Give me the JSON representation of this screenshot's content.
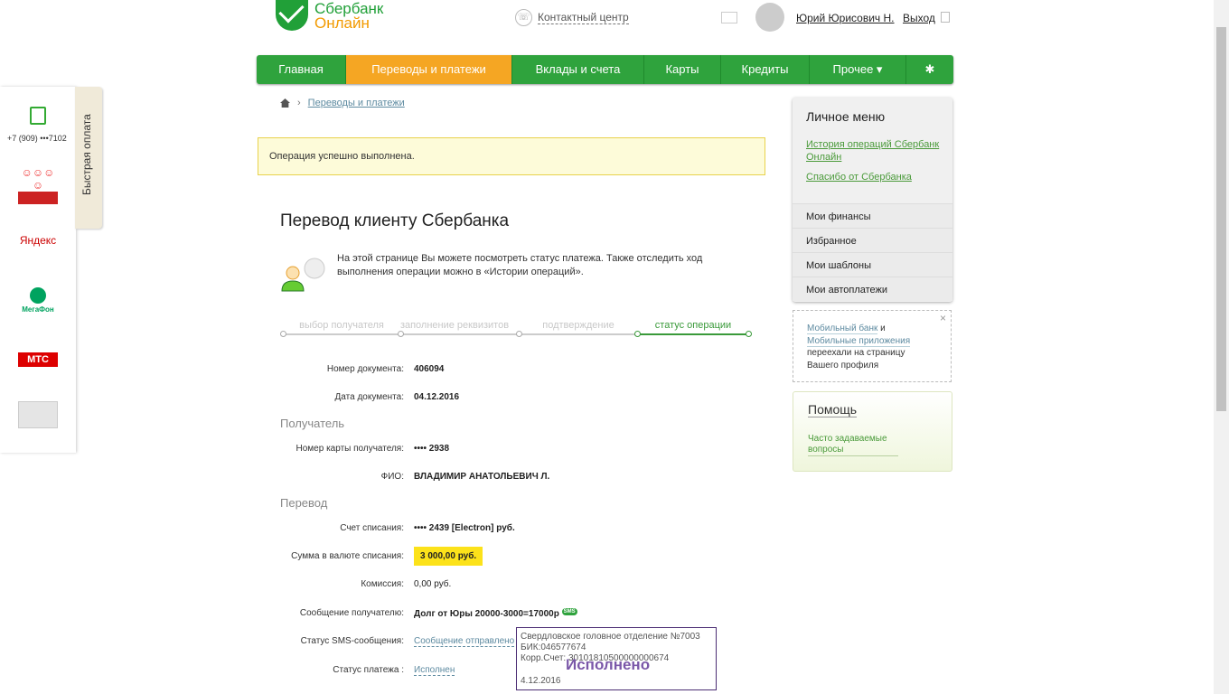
{
  "header": {
    "logo_line1": "Сбербанк",
    "logo_line2": "Онлайн",
    "contact_center": "Контактный центр",
    "user_name": "Юрий Юрисович Н.",
    "logout": "Выход"
  },
  "nav": [
    {
      "label": "Главная"
    },
    {
      "label": "Переводы и платежи",
      "active": true
    },
    {
      "label": "Вклады и счета"
    },
    {
      "label": "Карты"
    },
    {
      "label": "Кредиты"
    },
    {
      "label": "Прочее ▾"
    },
    {
      "label": "✱"
    }
  ],
  "breadcrumb": {
    "current": "Переводы и платежи"
  },
  "success_message": "Операция успешно выполнена.",
  "page_title": "Перевод клиенту Сбербанка",
  "hint": "На этой странице Вы можете посмотреть статус платежа. Также отследить ход выполнения операции можно в «Истории операций».",
  "steps": [
    "выбор получателя",
    "заполнение реквизитов",
    "подтверждение",
    "статус операции"
  ],
  "details": {
    "doc_number_label": "Номер документа:",
    "doc_number": "406094",
    "doc_date_label": "Дата документа:",
    "doc_date": "04.12.2016",
    "recipient_section": "Получатель",
    "card_label": "Номер карты получателя:",
    "card": "•••• 2938",
    "fio_label": "ФИО:",
    "fio": "ВЛАДИМИР АНАТОЛЬЕВИЧ Л.",
    "transfer_section": "Перевод",
    "account_label": "Счет списания:",
    "account": "•••• 2439  [Electron]  руб.",
    "amount_label": "Сумма в валюте списания:",
    "amount": "3 000,00  руб.",
    "fee_label": "Комиссия:",
    "fee": "0,00 руб.",
    "message_label": "Сообщение получателю:",
    "message": "Долг от Юры 20000-3000=17000р",
    "sms_badge": "SMS",
    "sms_status_label": "Статус SMS-сообщения:",
    "sms_status": "Сообщение отправлено",
    "payment_status_label": "Статус платежа :",
    "payment_status": "Исполнен"
  },
  "stamp": {
    "line1": "Свердловское головное отделение №7003",
    "line2": "БИК:046577674",
    "line3": "Корр.Счет: 30101810500000000674",
    "big": "Исполнено",
    "date": "4.12.2016"
  },
  "personal_menu": {
    "title": "Личное меню",
    "link1": "История операций Сбербанк Онлайн",
    "link2": "Спасибо от Сбербанка",
    "items": [
      "Мои финансы",
      "Избранное",
      "Мои шаблоны",
      "Мои автоплатежи"
    ]
  },
  "notice": {
    "link1": "Мобильный банк",
    "and": " и ",
    "link2": "Мобильные приложения",
    "text": "переехали на страницу Вашего профиля",
    "close": "×"
  },
  "help": {
    "title": "Помощь",
    "link": "Часто задаваемые вопросы"
  },
  "quick_pay": {
    "tab": "Быстрая оплата",
    "phone": "+7 (909) •••7102",
    "yandex": "Яндекс",
    "megafon": "МегаФон",
    "mts": "МТС"
  }
}
